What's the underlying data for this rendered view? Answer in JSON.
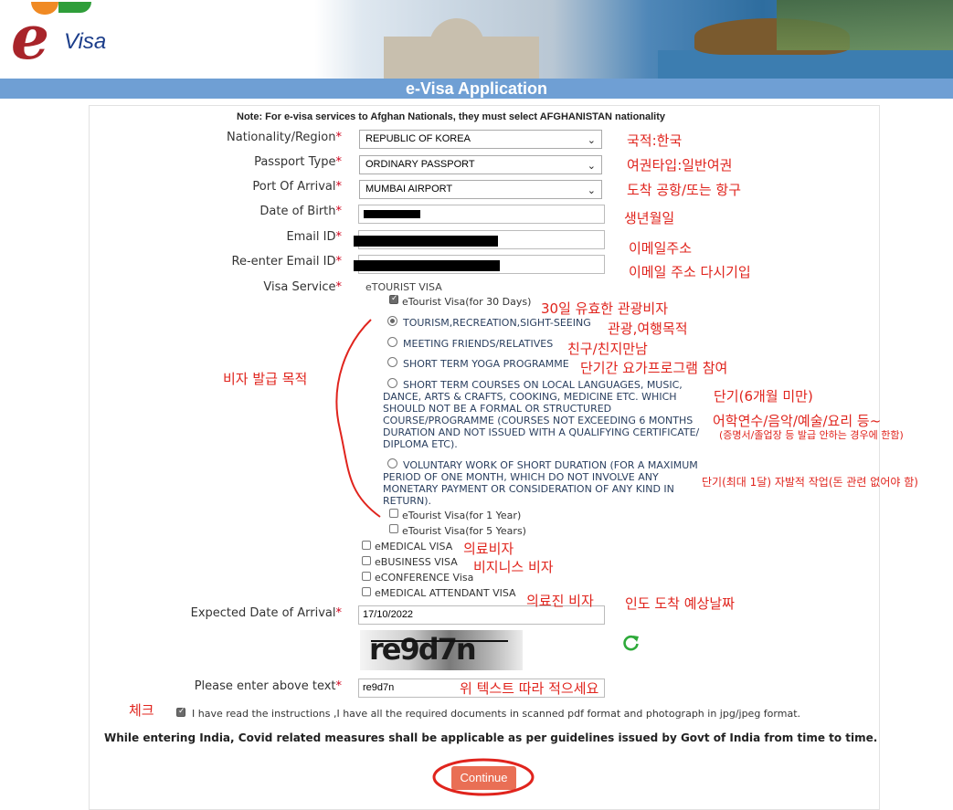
{
  "logo": {
    "text": "Visa",
    "letter": "e"
  },
  "page_title": "e-Visa Application",
  "note": "Note: For e-visa services to Afghan Nationals, they must select AFGHANISTAN nationality",
  "fields": {
    "nationality": {
      "label": "Nationality/Region",
      "value": "REPUBLIC OF KOREA"
    },
    "passport_type": {
      "label": "Passport Type",
      "value": "ORDINARY PASSPORT"
    },
    "port_of_arrival": {
      "label": "Port Of Arrival",
      "value": "MUMBAI AIRPORT"
    },
    "dob": {
      "label": "Date of Birth"
    },
    "email": {
      "label": "Email ID"
    },
    "re_email": {
      "label": "Re-enter Email ID"
    },
    "visa_service": {
      "label": "Visa Service",
      "value": "eTOURIST VISA"
    },
    "arrival_date": {
      "label": "Expected Date of Arrival",
      "value": "17/10/2022"
    },
    "captcha": {
      "label": "Please enter above text",
      "value": "re9d7n",
      "image_text": "re9d7n"
    }
  },
  "required_mark": "*",
  "visa": {
    "etourist_30": "eTourist Visa(for 30 Days)",
    "purposes": [
      "TOURISM,RECREATION,SIGHT-SEEING",
      "MEETING FRIENDS/RELATIVES",
      "SHORT TERM YOGA PROGRAMME",
      "SHORT TERM COURSES ON LOCAL LANGUAGES, MUSIC,",
      "DANCE, ARTS & CRAFTS, COOKING, MEDICINE ETC. WHICH",
      "SHOULD NOT BE A FORMAL OR STRUCTURED",
      "COURSE/PROGRAMME (COURSES NOT EXCEEDING 6 MONTHS",
      "DURATION AND NOT ISSUED WITH A QUALIFYING CERTIFICATE/",
      "DIPLOMA ETC).",
      "VOLUNTARY WORK OF SHORT DURATION (FOR A MAXIMUM",
      "PERIOD OF ONE MONTH, WHICH DO NOT INVOLVE ANY",
      "MONETARY PAYMENT OR CONSIDERATION OF ANY KIND IN",
      "RETURN)."
    ],
    "etourist_1y": "eTourist Visa(for 1 Year)",
    "etourist_5y": "eTourist Visa(for 5 Years)",
    "emedical": "eMEDICAL VISA",
    "ebusiness": "eBUSINESS VISA",
    "econference": "eCONFERENCE Visa",
    "emedical_attendant": "eMEDICAL ATTENDANT VISA"
  },
  "declaration": "I have read the instructions ,I have all the required documents in scanned pdf format and photograph in jpg/jpeg format.",
  "covid_note": "While entering India, Covid related measures shall be applicable as per guidelines issued by Govt of India from time to time.",
  "continue_label": "Continue",
  "annotations": {
    "nationality": "국적:한국",
    "passport": "여권타입:일반여권",
    "port": "도착 공항/또는 항구",
    "dob": "생년월일",
    "email": "이메일주소",
    "re_email": "이메일 주소 다시기입",
    "days30": "30일 유효한 관광비자",
    "tourism": "관광,여행목적",
    "friends": "친구/친지만남",
    "yoga": "단기간 요가프로그램 참여",
    "purpose": "비자 발급 목적",
    "short_term": "단기(6개월 미만)",
    "courses": "어학연수/음악/예술/요리 등~",
    "courses_note": "(증명서/졸업장 등 발급 안하는 경우에 한함)",
    "voluntary": "단기(최대 1달) 자발적 작업(돈 관련 없어야 함)",
    "medical": "의료비자",
    "business": "비지니스 비자",
    "attendant": "의료진 비자",
    "arrival": "인도 도착 예상날짜",
    "captcha": "위 텍스트 따라 적으세요",
    "check": "체크"
  },
  "colors": {
    "title_bar": "#6f9fd4",
    "annotation": "#e0241d",
    "continue": "#e96f55"
  }
}
